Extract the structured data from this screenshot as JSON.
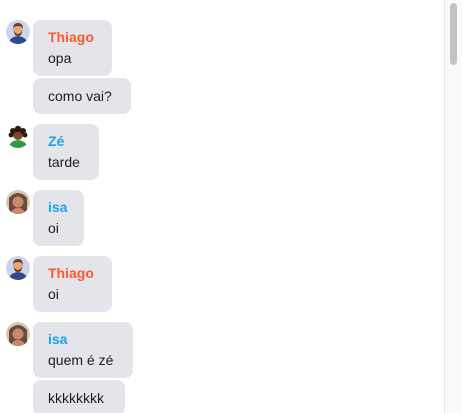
{
  "colors": {
    "thiago": "#fa5a2d",
    "ze": "#1aa3e8",
    "isa": "#1aa3e8",
    "bubble": "#e4e5ea"
  },
  "messages": [
    {
      "sender": "Thiago",
      "avatar": "thiago-avatar-icon",
      "lines": [
        "opa",
        "como vai?"
      ]
    },
    {
      "sender": "Zé",
      "avatar": "ze-avatar-icon",
      "lines": [
        "tarde"
      ]
    },
    {
      "sender": "isa",
      "avatar": "isa-avatar-icon",
      "lines": [
        "oi"
      ]
    },
    {
      "sender": "Thiago",
      "avatar": "thiago-avatar-icon",
      "lines": [
        "oi"
      ]
    },
    {
      "sender": "isa",
      "avatar": "isa-avatar-icon",
      "lines": [
        "quem é zé",
        "kkkkkkkk"
      ]
    }
  ]
}
